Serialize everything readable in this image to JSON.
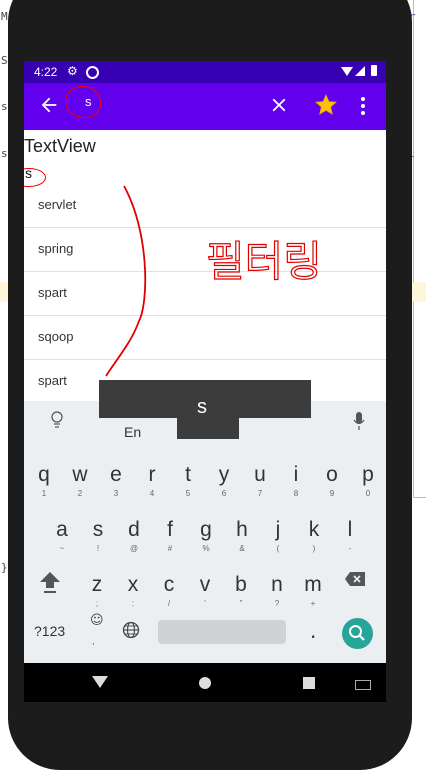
{
  "status_bar": {
    "time": "4:22"
  },
  "toolbar": {
    "search_query": "s"
  },
  "content": {
    "textview_title": "TextView",
    "textview_value": "s",
    "list_items": [
      "servlet",
      "spring",
      "spart",
      "sqoop",
      "spart"
    ]
  },
  "annotation": {
    "handwritten_text": "필터링",
    "color": "#e00000"
  },
  "keyboard": {
    "preview_key": "s",
    "language": "En",
    "row1": [
      {
        "c": "q",
        "s": "1"
      },
      {
        "c": "w",
        "s": "2"
      },
      {
        "c": "e",
        "s": "3"
      },
      {
        "c": "r",
        "s": "4"
      },
      {
        "c": "t",
        "s": "5"
      },
      {
        "c": "y",
        "s": "6"
      },
      {
        "c": "u",
        "s": "7"
      },
      {
        "c": "i",
        "s": "8"
      },
      {
        "c": "o",
        "s": "9"
      },
      {
        "c": "p",
        "s": "0"
      }
    ],
    "row2": [
      {
        "c": "a",
        "s": "~"
      },
      {
        "c": "s",
        "s": "!"
      },
      {
        "c": "d",
        "s": "@"
      },
      {
        "c": "f",
        "s": "#"
      },
      {
        "c": "g",
        "s": "%"
      },
      {
        "c": "h",
        "s": "&"
      },
      {
        "c": "j",
        "s": "("
      },
      {
        "c": "k",
        "s": ")"
      },
      {
        "c": "l",
        "s": "-"
      }
    ],
    "row3": [
      {
        "c": "z",
        "s": ";"
      },
      {
        "c": "x",
        "s": ":"
      },
      {
        "c": "c",
        "s": "/"
      },
      {
        "c": "v",
        "s": "'"
      },
      {
        "c": "b",
        "s": "\""
      },
      {
        "c": "n",
        "s": "?"
      },
      {
        "c": "m",
        "s": "+"
      }
    ],
    "symbols_label": "?123",
    "emoji_label": "☺",
    "comma_hint": ",",
    "period_label": "."
  },
  "colors": {
    "status_bar": "#3700b3",
    "toolbar": "#6200ee",
    "enter": "#26a69a",
    "star": "#ffc107"
  }
}
